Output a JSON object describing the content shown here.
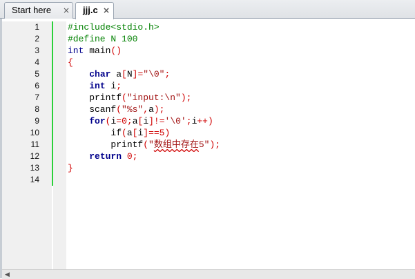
{
  "tabs": [
    {
      "label": "Start here",
      "close": "×",
      "active": false
    },
    {
      "label": "jjj.c",
      "close": "×",
      "active": true
    }
  ],
  "editor": {
    "line_numbers": [
      "1",
      "2",
      "3",
      "4",
      "5",
      "6",
      "7",
      "8",
      "9",
      "10",
      "11",
      "12",
      "13",
      "14"
    ],
    "lines": [
      {
        "tokens": [
          {
            "t": "#include<stdio.h>",
            "c": "pp"
          }
        ]
      },
      {
        "tokens": [
          {
            "t": "#define N 100",
            "c": "pp"
          }
        ]
      },
      {
        "tokens": [
          {
            "t": "int",
            "c": "ty"
          },
          {
            "t": " main",
            "c": "tx"
          },
          {
            "t": "()",
            "c": "op"
          }
        ]
      },
      {
        "tokens": [
          {
            "t": "{",
            "c": "op"
          }
        ]
      },
      {
        "tokens": [
          {
            "t": "    ",
            "c": "tx"
          },
          {
            "t": "char",
            "c": "kw"
          },
          {
            "t": " a",
            "c": "tx"
          },
          {
            "t": "[",
            "c": "op"
          },
          {
            "t": "N",
            "c": "tx"
          },
          {
            "t": "]=",
            "c": "op"
          },
          {
            "t": "\"\\0\"",
            "c": "str"
          },
          {
            "t": ";",
            "c": "op"
          }
        ]
      },
      {
        "tokens": [
          {
            "t": "    ",
            "c": "tx"
          },
          {
            "t": "int",
            "c": "kw"
          },
          {
            "t": " i",
            "c": "tx"
          },
          {
            "t": ";",
            "c": "op"
          }
        ]
      },
      {
        "tokens": [
          {
            "t": "    printf",
            "c": "tx"
          },
          {
            "t": "(",
            "c": "op"
          },
          {
            "t": "\"input:\\n\"",
            "c": "str"
          },
          {
            "t": ");",
            "c": "op"
          }
        ]
      },
      {
        "tokens": [
          {
            "t": "    scanf",
            "c": "tx"
          },
          {
            "t": "(",
            "c": "op"
          },
          {
            "t": "\"%s\"",
            "c": "str"
          },
          {
            "t": ",",
            "c": "op"
          },
          {
            "t": "a",
            "c": "tx"
          },
          {
            "t": ");",
            "c": "op"
          }
        ]
      },
      {
        "tokens": [
          {
            "t": "    ",
            "c": "tx"
          },
          {
            "t": "for",
            "c": "kw"
          },
          {
            "t": "(",
            "c": "op"
          },
          {
            "t": "i",
            "c": "tx"
          },
          {
            "t": "=",
            "c": "op"
          },
          {
            "t": "0",
            "c": "cn"
          },
          {
            "t": ";",
            "c": "op"
          },
          {
            "t": "a",
            "c": "tx"
          },
          {
            "t": "[",
            "c": "op"
          },
          {
            "t": "i",
            "c": "tx"
          },
          {
            "t": "]!=",
            "c": "op"
          },
          {
            "t": "'\\0'",
            "c": "str"
          },
          {
            "t": ";",
            "c": "op"
          },
          {
            "t": "i",
            "c": "tx"
          },
          {
            "t": "++)",
            "c": "op"
          }
        ]
      },
      {
        "tokens": [
          {
            "t": "        if",
            "c": "tx"
          },
          {
            "t": "(",
            "c": "op"
          },
          {
            "t": "a",
            "c": "tx"
          },
          {
            "t": "[",
            "c": "op"
          },
          {
            "t": "i",
            "c": "tx"
          },
          {
            "t": "]==",
            "c": "op"
          },
          {
            "t": "5",
            "c": "cn"
          },
          {
            "t": ")",
            "c": "op"
          }
        ]
      },
      {
        "tokens": [
          {
            "t": "        printf",
            "c": "tx"
          },
          {
            "t": "(",
            "c": "op"
          },
          {
            "t": "\"",
            "c": "str"
          },
          {
            "t": "数组中存在",
            "c": "str sq"
          },
          {
            "t": "5\"",
            "c": "str"
          },
          {
            "t": ");",
            "c": "op"
          }
        ]
      },
      {
        "tokens": [
          {
            "t": "    ",
            "c": "tx"
          },
          {
            "t": "return",
            "c": "kw"
          },
          {
            "t": " ",
            "c": "tx"
          },
          {
            "t": "0",
            "c": "cn"
          },
          {
            "t": ";",
            "c": "op"
          }
        ]
      },
      {
        "tokens": [
          {
            "t": "}",
            "c": "op"
          }
        ]
      },
      {
        "tokens": []
      }
    ]
  },
  "colors": {
    "preprocessor": "#008000",
    "keyword": "#00008b",
    "string": "#a31515",
    "number": "#d00000",
    "change_bar": "#2bd13a"
  },
  "icons": {
    "tab_close": "close-icon",
    "scroll_left": "arrow-left-icon"
  }
}
